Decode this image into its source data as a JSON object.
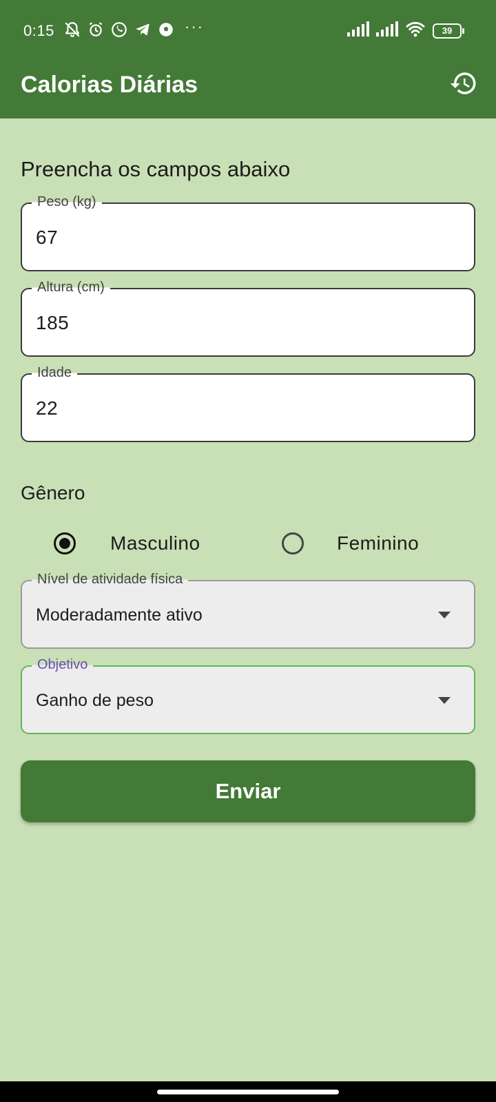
{
  "status_bar": {
    "time": "0:15",
    "left_icons": [
      "muted-bell-icon",
      "alarm-icon",
      "whatsapp-icon",
      "telegram-icon",
      "soccer-ball-icon"
    ],
    "more_indicator": "···",
    "battery": "39"
  },
  "app_bar": {
    "title": "Calorias Diárias",
    "history_icon": "history-icon"
  },
  "form": {
    "heading": "Preencha os campos abaixo",
    "weight": {
      "label": "Peso (kg)",
      "value": "67"
    },
    "height": {
      "label": "Altura (cm)",
      "value": "185"
    },
    "age": {
      "label": "Idade",
      "value": "22"
    },
    "gender": {
      "label": "Gênero",
      "options": [
        {
          "label": "Masculino",
          "selected": true
        },
        {
          "label": "Feminino",
          "selected": false
        }
      ]
    },
    "activity": {
      "label": "Nível de atividade física",
      "value": "Moderadamente ativo"
    },
    "goal": {
      "label": "Objetivo",
      "value": "Ganho de peso"
    },
    "submit_label": "Enviar"
  },
  "colors": {
    "primary": "#437a37",
    "background": "#c9dfb6",
    "focus_border": "#5cb85c",
    "focus_label": "#6a4fb3"
  }
}
